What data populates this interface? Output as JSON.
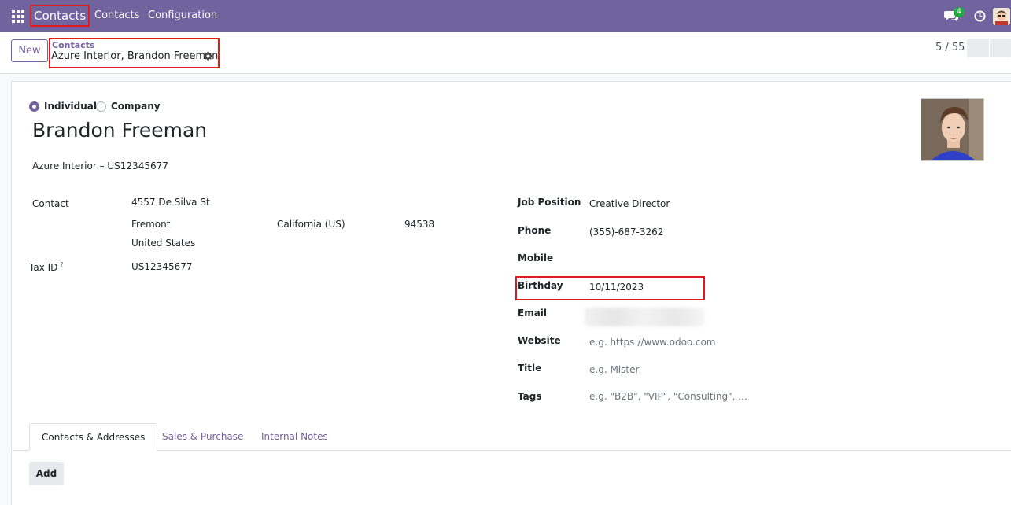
{
  "navbar": {
    "brand": "Contacts",
    "links": [
      "Contacts",
      "Configuration"
    ],
    "chat_badge": "4",
    "accent": "#71639e"
  },
  "control": {
    "new_label": "New",
    "breadcrumb_parent": "Contacts",
    "breadcrumb_current": "Azure Interior, Brandon Freeman",
    "pager": "5 / 55"
  },
  "form": {
    "type_options": [
      "Individual",
      "Company"
    ],
    "type_selected": "Individual",
    "name": "Brandon Freeman",
    "company": "Azure Interior – US12345677",
    "address": {
      "label": "Contact",
      "street": "4557 De Silva St",
      "city": "Fremont",
      "state": "California (US)",
      "zip": "94538",
      "country": "United States"
    },
    "tax": {
      "label": "Tax ID",
      "help": "?",
      "value": "US12345677"
    },
    "right_fields": {
      "job_position": {
        "label": "Job Position",
        "value": "Creative Director"
      },
      "phone": {
        "label": "Phone",
        "value": "(355)-687-3262"
      },
      "mobile": {
        "label": "Mobile",
        "value": ""
      },
      "birthday": {
        "label": "Birthday",
        "value": "10/11/2023"
      },
      "email": {
        "label": "Email",
        "value": ""
      },
      "website": {
        "label": "Website",
        "placeholder": "e.g. https://www.odoo.com"
      },
      "title": {
        "label": "Title",
        "placeholder": "e.g. Mister"
      },
      "tags": {
        "label": "Tags",
        "placeholder": "e.g. \"B2B\", \"VIP\", \"Consulting\", ..."
      }
    }
  },
  "tabs": [
    "Contacts & Addresses",
    "Sales & Purchase",
    "Internal Notes"
  ],
  "active_tab": "Contacts & Addresses",
  "add_label": "Add",
  "icons": [
    "apps-grid-icon",
    "chat-icon",
    "clock-icon",
    "gear-icon",
    "user-avatar"
  ]
}
